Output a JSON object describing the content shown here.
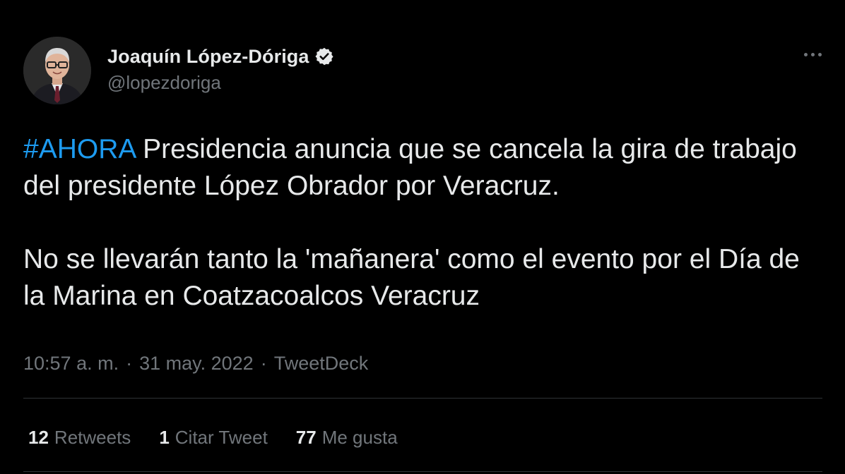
{
  "author": {
    "display_name": "Joaquín López-Dóriga",
    "handle": "@lopezdoriga",
    "verified": true,
    "avatar_icon": "profile-photo"
  },
  "tweet": {
    "hashtag": "#AHORA",
    "paragraph1_rest": " Presidencia anuncia que se cancela la gira de trabajo del presidente López Obrador por Veracruz.",
    "paragraph2": "No se llevarán tanto la 'mañanera' como el evento por el Día de la Marina en Coatzacoalcos Veracruz"
  },
  "meta": {
    "time": "10:57 a. m.",
    "separator": "·",
    "date": "31 may. 2022",
    "source": "TweetDeck"
  },
  "stats": {
    "retweets_count": "12",
    "retweets_label": "Retweets",
    "quotes_count": "1",
    "quotes_label": "Citar Tweet",
    "likes_count": "77",
    "likes_label": "Me gusta"
  },
  "colors": {
    "background": "#000000",
    "text": "#e7e9ea",
    "secondary": "#71767b",
    "accent": "#1d9bf0",
    "divider": "#2f3336"
  }
}
